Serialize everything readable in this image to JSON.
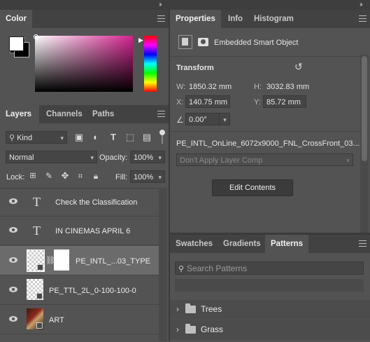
{
  "color_panel": {
    "tab": "Color"
  },
  "layers_panel": {
    "tabs": [
      "Layers",
      "Channels",
      "Paths"
    ],
    "kind_filter": "Kind",
    "blend_mode": "Normal",
    "opacity_label": "Opacity:",
    "opacity_value": "100%",
    "lock_label": "Lock:",
    "fill_label": "Fill:",
    "fill_value": "100%",
    "layers": [
      {
        "name": "Check the Classification",
        "type": "text"
      },
      {
        "name": "IN CINEMAS APRIL 6",
        "type": "text"
      },
      {
        "name": "PE_INTL_...03_TYPE",
        "type": "smart-object-masked",
        "selected": true
      },
      {
        "name": "PE_TTL_2L_0-100-100-0",
        "type": "smart-object"
      },
      {
        "name": "ART",
        "type": "smart-object-image"
      }
    ]
  },
  "properties_panel": {
    "tabs": [
      "Properties",
      "Info",
      "Histogram"
    ],
    "object_type": "Embedded Smart Object",
    "section_title": "Transform",
    "w_label": "W:",
    "w_value": "1850.32 mm",
    "h_label": "H:",
    "h_value": "3032.83 mm",
    "x_label": "X:",
    "x_value": "140.75 mm",
    "y_label": "Y:",
    "y_value": "85.72 mm",
    "angle_value": "0.00°",
    "filename": "PE_INTL_OnLine_6072x9000_FNL_CrossFront_03....",
    "layer_comp": "Don't Apply Layer Comp",
    "edit_button": "Edit Contents"
  },
  "patterns_panel": {
    "tabs": [
      "Swatches",
      "Gradients",
      "Patterns"
    ],
    "search_placeholder": "Search Patterns",
    "folders": [
      "Trees",
      "Grass"
    ]
  },
  "colors": {
    "foreground": "#ffffff",
    "background": "#000000"
  }
}
